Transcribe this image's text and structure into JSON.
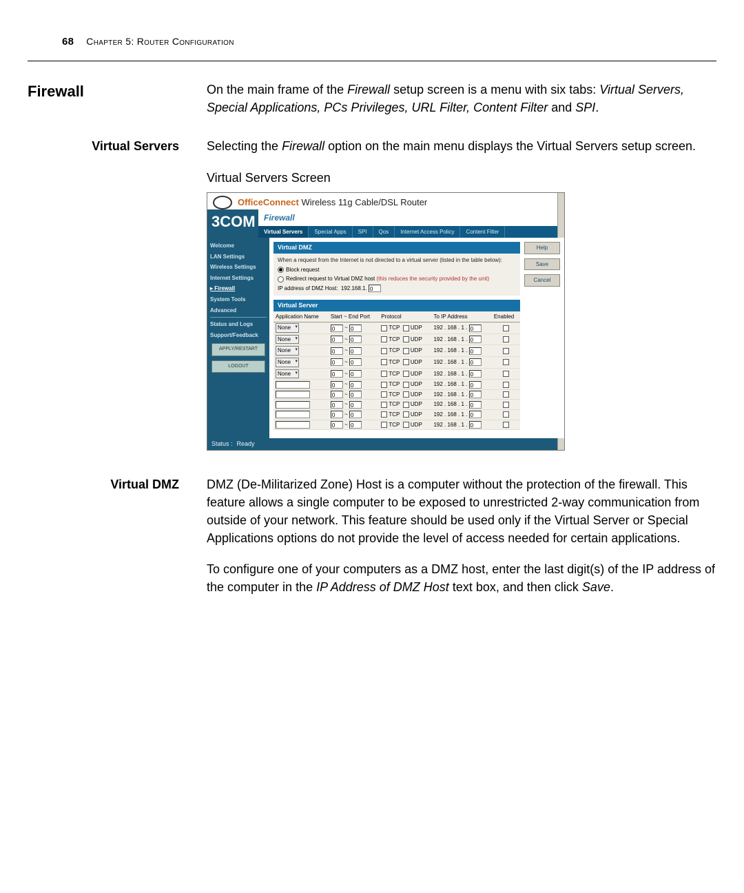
{
  "page": {
    "number": "68",
    "chapter_label": "Chapter 5: Router Configuration"
  },
  "section": {
    "firewall_heading": "Firewall",
    "firewall_text_a": "On the main frame of the ",
    "firewall_text_b": " setup screen is a menu with six tabs: ",
    "firewall_text_c": " and ",
    "firewall_text_end": ".",
    "firewall_em": "Firewall",
    "tabs_list": "Virtual Servers, Special Applications, PCs Privileges, URL Filter, Content Filter",
    "spi_em": "SPI"
  },
  "vs": {
    "heading": "Virtual Servers",
    "text_a": "Selecting the ",
    "text_em": "Firewall",
    "text_b": " option on the main menu displays the Virtual Servers setup screen.",
    "caption": "Virtual Servers Screen"
  },
  "dmz": {
    "heading": "Virtual DMZ",
    "para1": "DMZ (De-Militarized Zone) Host is a computer without the protection of the firewall. This feature allows a single computer to be exposed to unrestricted 2-way communication from outside of your network. This feature should be used only if the Virtual Server or Special Applications options do not provide the level of access needed for certain applications.",
    "para2_a": "To configure one of your computers as a DMZ host, enter the last digit(s) of the IP address of the computer in the ",
    "para2_em": "IP Address of DMZ Host",
    "para2_b": " text box, and then click ",
    "para2_em2": "Save",
    "para2_end": "."
  },
  "shot": {
    "brand_oc": "OfficeConnect",
    "brand_rest": " Wireless 11g Cable/DSL Router",
    "threecom": "3COM",
    "crumb": "Firewall",
    "sidebar": {
      "items": [
        "Welcome",
        "LAN Settings",
        "Wireless Settings",
        "Internet Settings",
        "Firewall",
        "System Tools",
        "Advanced"
      ],
      "group2": [
        "Status and Logs",
        "Support/Feedback"
      ],
      "btn_apply": "APPLY/RESTART",
      "btn_logout": "LOGOUT"
    },
    "tabs": [
      "Virtual Servers",
      "Special Apps",
      "SPI",
      "Qos",
      "Internet Access Policy",
      "Content Filter"
    ],
    "dmz_panel": {
      "title": "Virtual DMZ",
      "note": "When a request from the Internet is not directed to a virtual server (listed in the table below):",
      "opt_block": "Block request",
      "opt_redirect_a": "Redirect request to Virtual DMZ host ",
      "opt_redirect_warn": "(this reduces the security provided by the unit)",
      "ip_label": "IP address of DMZ Host:",
      "ip_prefix": "192.168.1.",
      "ip_val": "0"
    },
    "btns": {
      "help": "Help",
      "save": "Save",
      "cancel": "Cancel"
    },
    "vs_panel": {
      "title": "Virtual Server",
      "headers": [
        "Application Name",
        "Start ~ End Port",
        "Protocol",
        "To IP Address",
        "Enabled"
      ],
      "select_default": "None",
      "port_default": "0",
      "tilde": "~",
      "proto_tcp": "TCP",
      "proto_udp": "UDP",
      "ip_prefix": "192 . 168 . 1 .",
      "ip_last": "0"
    },
    "status_label": "Status :",
    "status_value": "Ready"
  }
}
